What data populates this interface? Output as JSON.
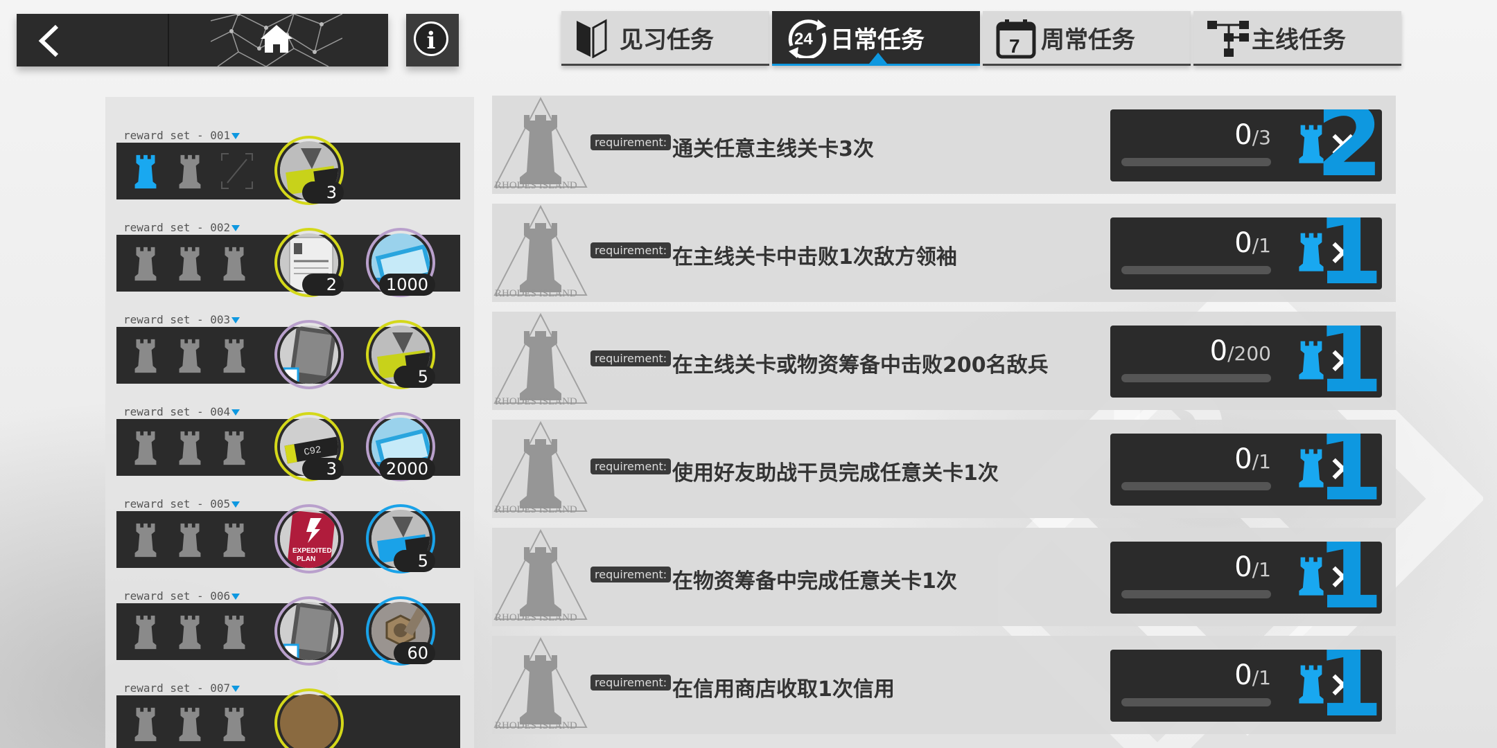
{
  "nav": {
    "back_icon": "chevron-left-icon",
    "home_icon": "home-icon",
    "info_icon": "info-icon"
  },
  "tabs": [
    {
      "label": "见习任务",
      "icon": "trainee-flag-icon",
      "active": false
    },
    {
      "label": "日常任务",
      "icon": "daily-24-icon",
      "active": true
    },
    {
      "label": "周常任务",
      "icon": "calendar-7-icon",
      "active": false
    },
    {
      "label": "主线任务",
      "icon": "tree-icon",
      "active": false
    }
  ],
  "reward_sets": [
    {
      "label": "reward set - 001",
      "rooks_lit": 1,
      "items": [
        {
          "name": "exp-card-yellow",
          "ring": "yellow",
          "count": "3"
        }
      ]
    },
    {
      "label": "reward set - 002",
      "rooks_lit": 0,
      "items": [
        {
          "name": "recruitment-permit",
          "ring": "yellow",
          "count": "2"
        },
        {
          "name": "lmd-money",
          "ring": "purple",
          "count": "1000"
        }
      ]
    },
    {
      "label": "reward set - 003",
      "rooks_lit": 0,
      "items": [
        {
          "name": "chip-pack",
          "ring": "purple",
          "count": ""
        },
        {
          "name": "exp-card-yellow",
          "ring": "yellow",
          "count": "5"
        }
      ]
    },
    {
      "label": "reward set - 004",
      "rooks_lit": 0,
      "items": [
        {
          "name": "device-yellow",
          "ring": "yellow",
          "count": "3"
        },
        {
          "name": "lmd-money",
          "ring": "purple",
          "count": "2000"
        }
      ]
    },
    {
      "label": "reward set - 005",
      "rooks_lit": 0,
      "items": [
        {
          "name": "expedited-plan",
          "ring": "purple",
          "count": "",
          "text": "EXPEDITED PLAN"
        },
        {
          "name": "exp-card-blue",
          "ring": "blue",
          "count": "5"
        }
      ]
    },
    {
      "label": "reward set - 006",
      "rooks_lit": 0,
      "items": [
        {
          "name": "chip-pack",
          "ring": "purple",
          "count": ""
        },
        {
          "name": "bolt-nut",
          "ring": "blue",
          "count": "60"
        }
      ]
    },
    {
      "label": "reward set - 007",
      "rooks_lit": 0,
      "items": []
    }
  ],
  "tasks": [
    {
      "requirement": "requirement:",
      "desc": "通关任意主线关卡3次",
      "current": "0",
      "total": "/3",
      "reward": "2",
      "progress": 0
    },
    {
      "requirement": "requirement:",
      "desc": "在主线关卡中击败1次敌方领袖",
      "current": "0",
      "total": "/1",
      "reward": "1",
      "progress": 0
    },
    {
      "requirement": "requirement:",
      "desc": "在主线关卡或物资筹备中击败200名敌兵",
      "current": "0",
      "total": "/200",
      "reward": "1",
      "progress": 0
    },
    {
      "requirement": "requirement:",
      "desc": "使用好友助战干员完成任意关卡1次",
      "current": "0",
      "total": "/1",
      "reward": "1",
      "progress": 0
    },
    {
      "requirement": "requirement:",
      "desc": "在物资筹备中完成任意关卡1次",
      "current": "0",
      "total": "/1",
      "reward": "1",
      "progress": 0
    },
    {
      "requirement": "requirement:",
      "desc": "在信用商店收取1次信用",
      "current": "0",
      "total": "/1",
      "reward": "1",
      "progress": 0
    }
  ],
  "task_emblem_text": "RHODES ISLAND",
  "reward_multiplier": "×",
  "colors": {
    "accent": "#0e98e0",
    "dark": "#2b2b2b",
    "rook_lit": "#19a8f0",
    "rook_dim": "#8a8a8a"
  }
}
